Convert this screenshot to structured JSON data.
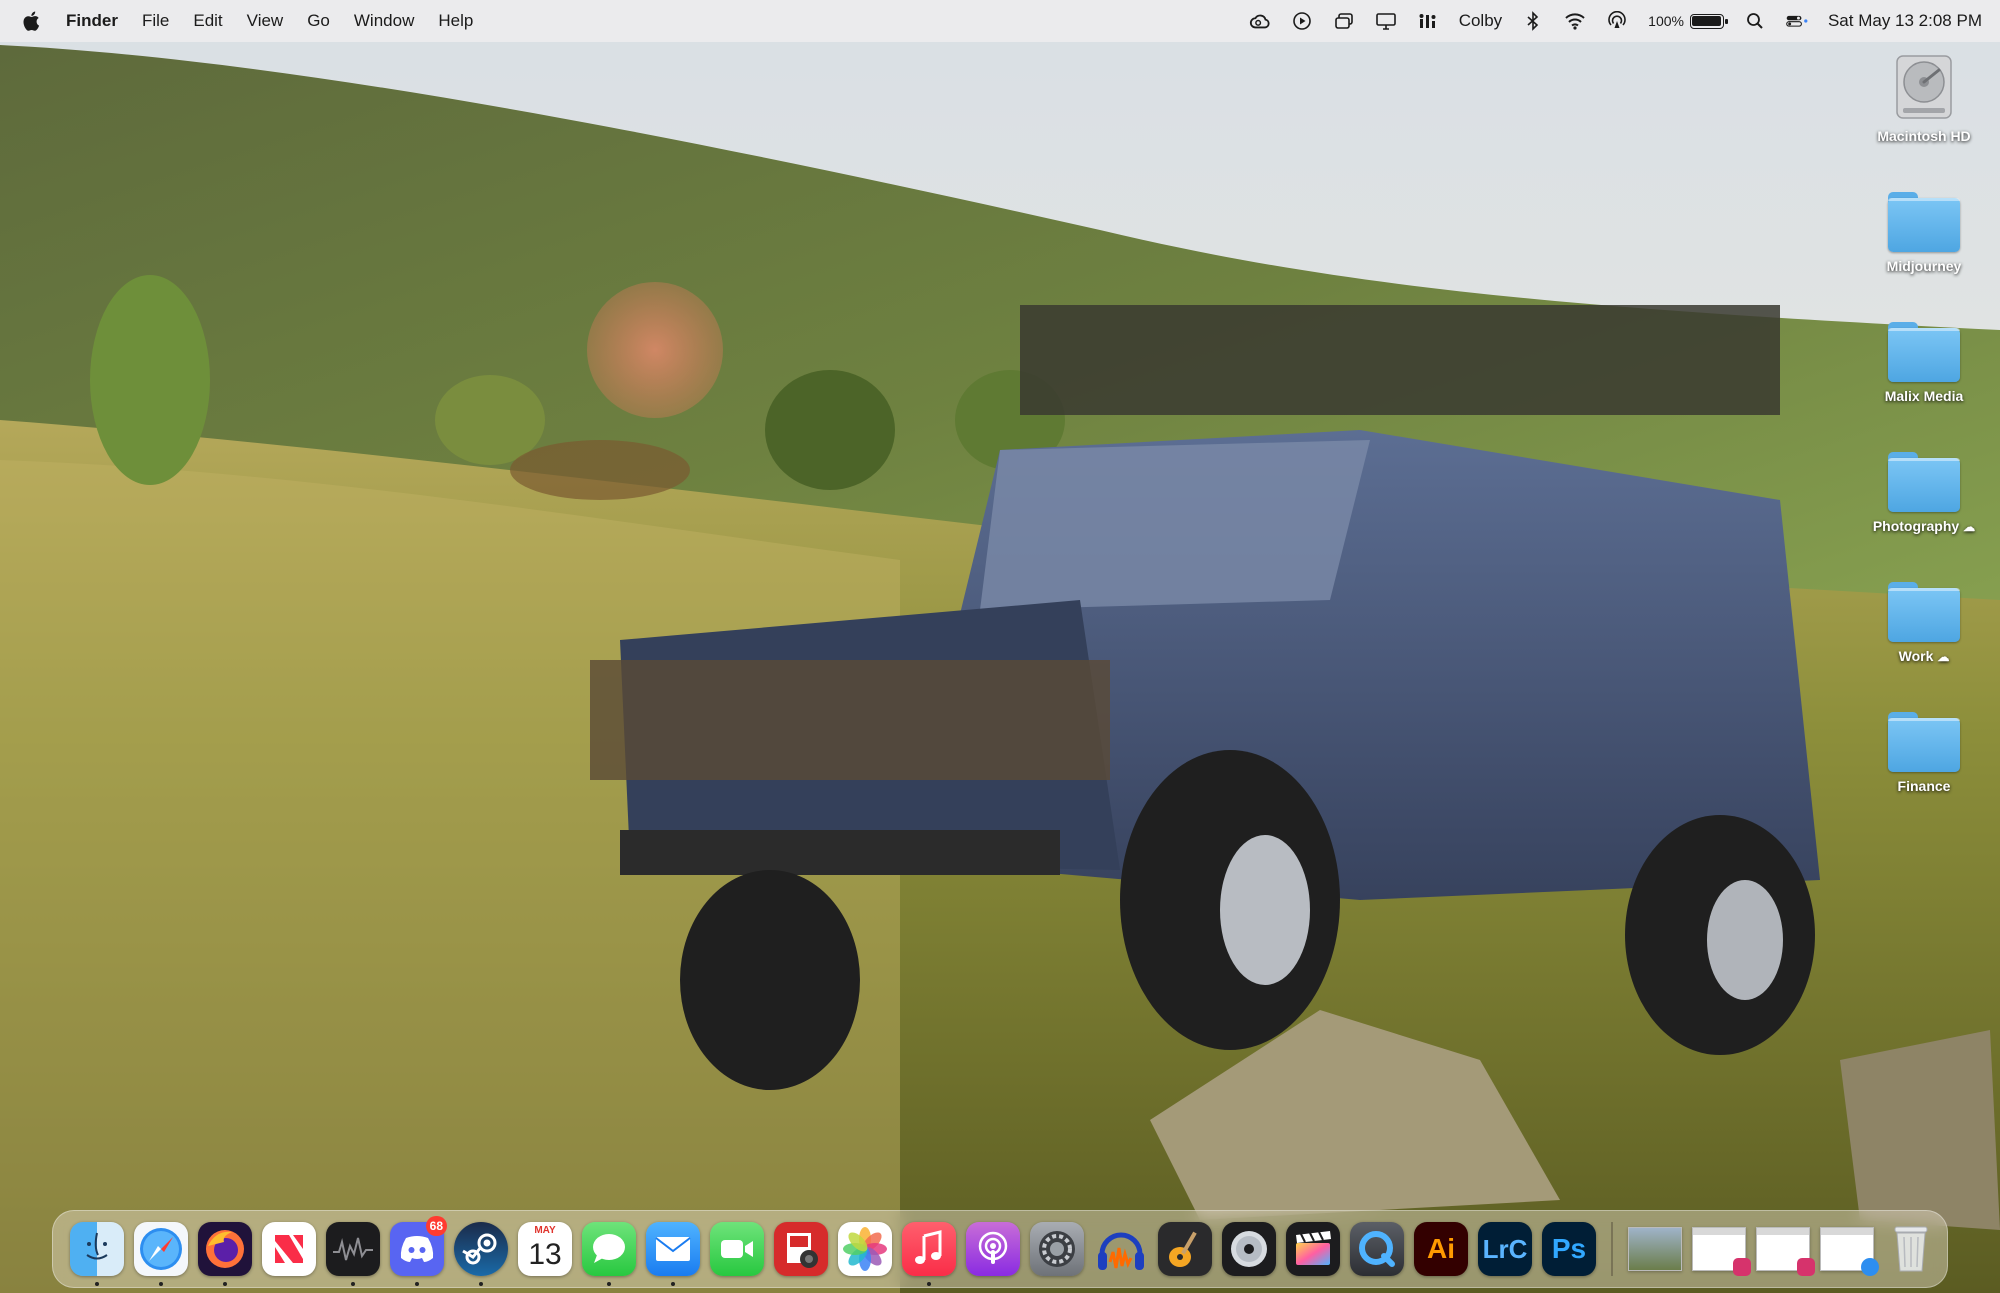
{
  "menubar": {
    "app_name": "Finder",
    "menus": [
      "File",
      "Edit",
      "View",
      "Go",
      "Window",
      "Help"
    ],
    "user": "Colby",
    "battery_percent": "100%",
    "battery_level": 1.0,
    "datetime": "Sat May 13  2:08 PM"
  },
  "desktop_icons": [
    {
      "label": "Macintosh HD",
      "icon": "hard-drive-icon"
    },
    {
      "label": "Midjourney",
      "icon": "folder-icon"
    },
    {
      "label": "Malix Media",
      "icon": "folder-icon"
    },
    {
      "label": "Photography",
      "icon": "folder-icon",
      "cloud": true
    },
    {
      "label": "Work",
      "icon": "folder-icon",
      "cloud": true
    },
    {
      "label": "Finance",
      "icon": "folder-icon"
    }
  ],
  "dock": {
    "discord_badge": "68",
    "calendar_month": "MAY",
    "calendar_day": "13",
    "illustrator_label": "Ai",
    "lightroom_label": "LrC",
    "photoshop_label": "Ps"
  },
  "colors": {
    "folder_blue": "#5aaee8",
    "badge_red": "#ff3b30"
  }
}
